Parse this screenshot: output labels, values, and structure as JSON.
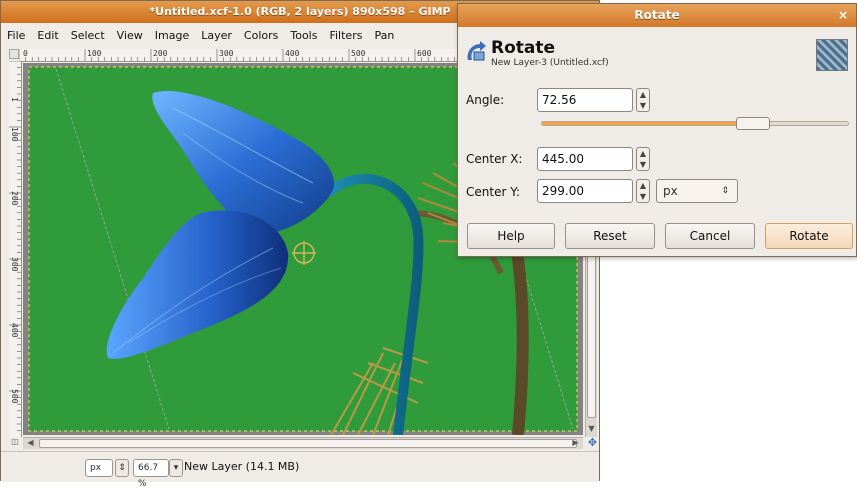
{
  "gimp": {
    "title": "*Untitled.xcf-1.0 (RGB, 2 layers) 890x598 – GIMP",
    "menu": [
      "File",
      "Edit",
      "Select",
      "View",
      "Image",
      "Layer",
      "Colors",
      "Tools",
      "Filters",
      "Pan"
    ],
    "ruler_labels": [
      "0",
      "100",
      "200",
      "300",
      "400",
      "500",
      "600"
    ],
    "vruler_labels": [
      "1",
      "100",
      "200",
      "300",
      "400",
      "500"
    ],
    "status": {
      "unit": "px",
      "zoom": "66.7 %",
      "message": "New Layer (14.1 MB)"
    },
    "icons": {
      "scroll_left": "triangle-left",
      "scroll_right": "triangle-right",
      "scroll_down": "triangle-down",
      "navigate": "four-arrow-navigate",
      "zoom_corner": "zoom-fit"
    },
    "colors": {
      "canvas_bg": "#2f9b3b",
      "titlebar": "#d87a26"
    }
  },
  "rotate": {
    "window_title": "Rotate",
    "close_icon": "×",
    "heading": "Rotate",
    "subtitle": "New Layer-3 (Untitled.xcf)",
    "angle_label": "Angle:",
    "angle_value": "72.56",
    "angle_fraction": 0.7,
    "center_x_label": "Center X:",
    "center_x_value": "445.00",
    "center_y_label": "Center Y:",
    "center_y_value": "299.00",
    "unit": "px",
    "buttons": {
      "help": "Help",
      "reset": "Reset",
      "cancel": "Cancel",
      "rotate": "Rotate"
    }
  }
}
